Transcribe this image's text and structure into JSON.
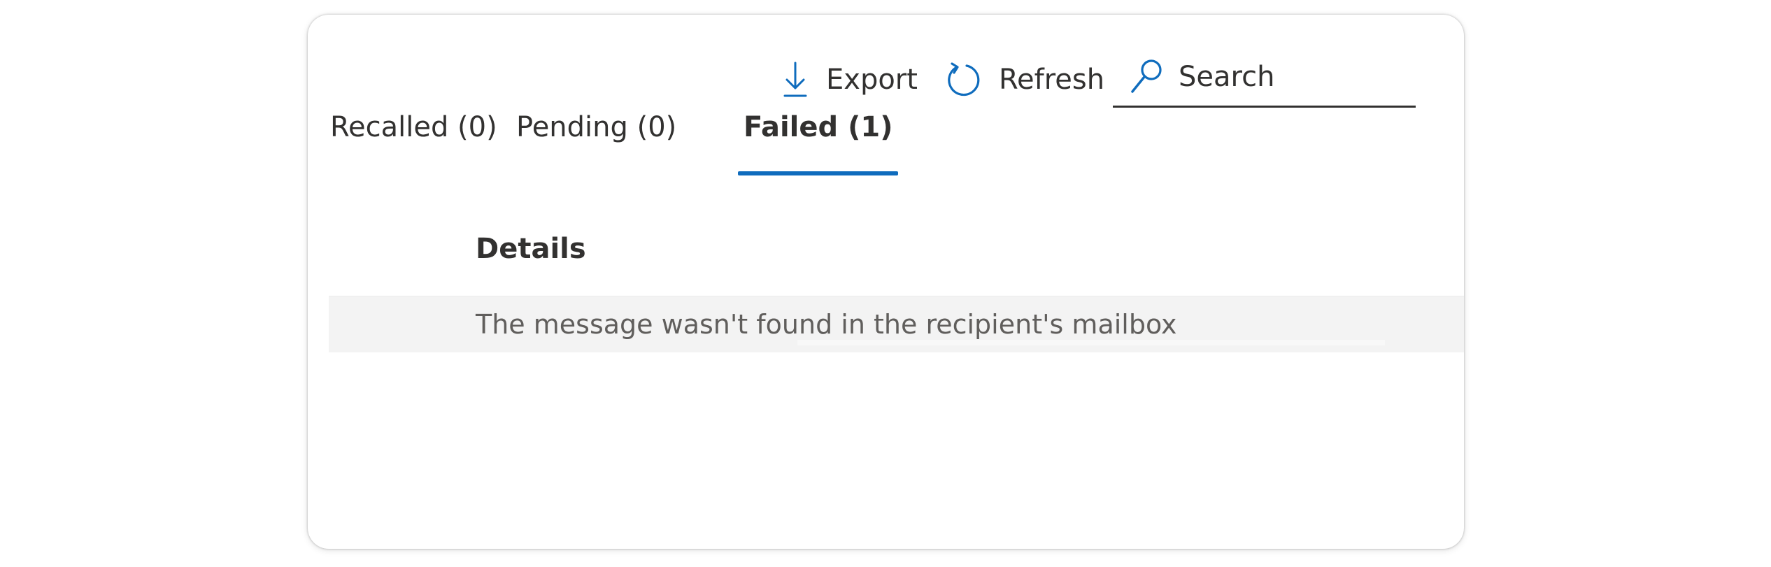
{
  "toolbar": {
    "export_label": "Export",
    "refresh_label": "Refresh",
    "search_placeholder": "Search",
    "search_value": ""
  },
  "tabs": [
    {
      "label": "Recalled (0)",
      "selected": false
    },
    {
      "label": "Pending (0)",
      "selected": false
    },
    {
      "label": "Failed (1)",
      "selected": true
    }
  ],
  "table": {
    "column_header": "Details",
    "rows": [
      {
        "details": "The message wasn't found in the recipient's mailbox"
      }
    ]
  },
  "colors": {
    "accent": "#0f6cbd",
    "text": "#323130",
    "secondary_text": "#605e5c",
    "row_background": "#f3f3f3"
  },
  "icons": {
    "export": "download-arrow-icon",
    "refresh": "refresh-icon",
    "search": "search-icon"
  }
}
